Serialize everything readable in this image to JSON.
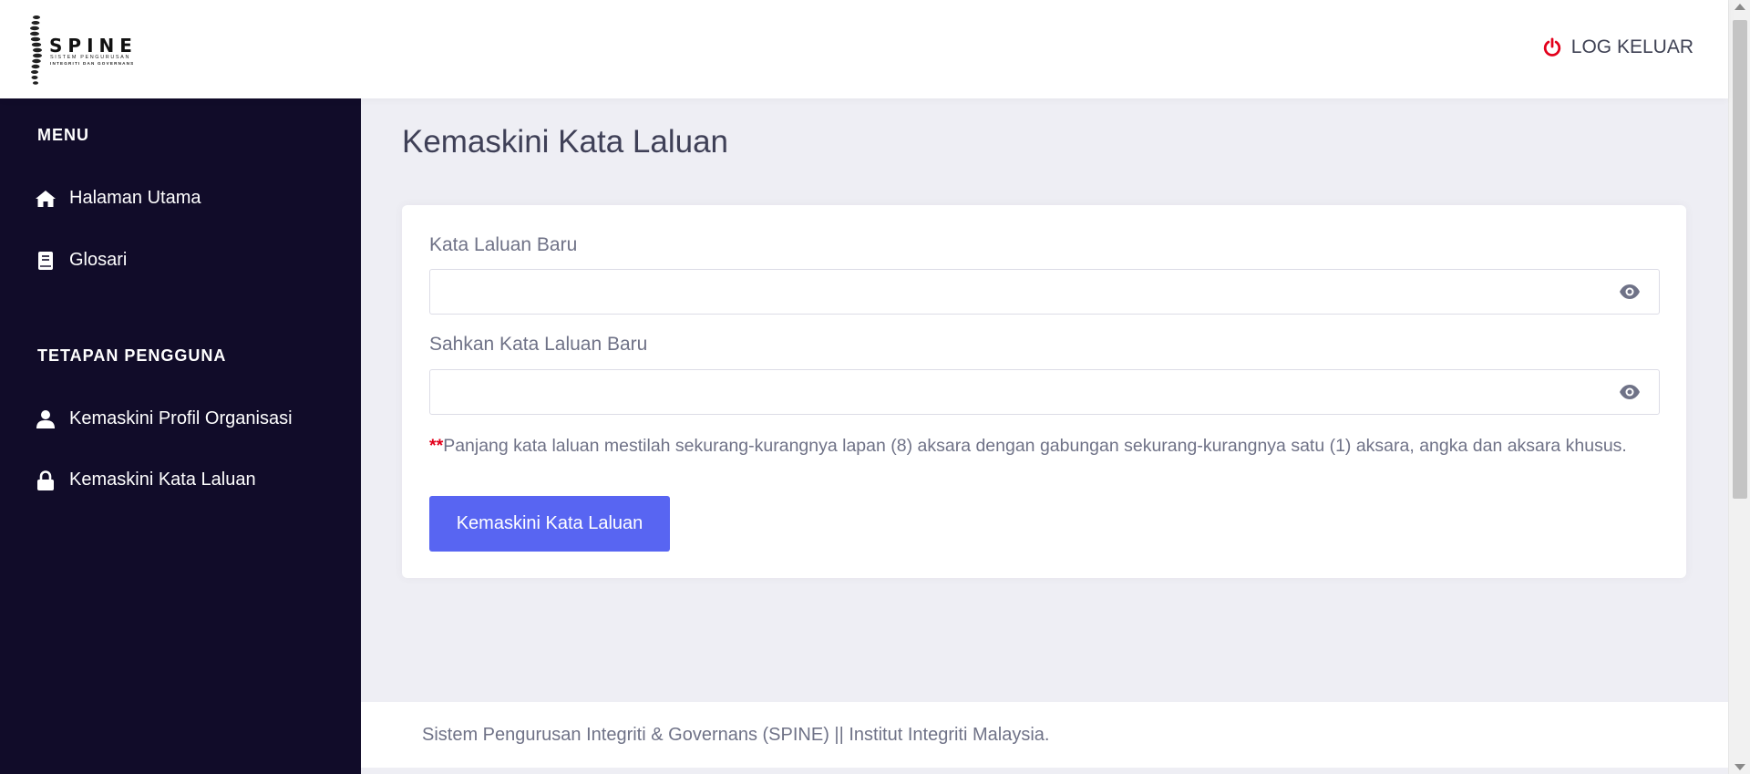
{
  "header": {
    "logo": {
      "name": "SPINE",
      "subtitle_line1": "SISTEM PENGURUSAN",
      "subtitle_line2": "INTEGRITI DAN GOVERNANS"
    },
    "logout_label": "LOG KELUAR",
    "logout_icon": "power-icon",
    "logout_icon_color": "#e3001b"
  },
  "sidebar": {
    "menu_heading": "MENU",
    "menu_items": [
      {
        "label": "Halaman Utama",
        "icon": "home-icon"
      },
      {
        "label": "Glosari",
        "icon": "book-icon"
      }
    ],
    "settings_heading": "TETAPAN PENGGUNA",
    "settings_items": [
      {
        "label": "Kemaskini Profil Organisasi",
        "icon": "user-icon"
      },
      {
        "label": "Kemaskini Kata Laluan",
        "icon": "lock-icon"
      }
    ],
    "background": "#110c29"
  },
  "main": {
    "title": "Kemaskini Kata Laluan",
    "form": {
      "new_password_label": "Kata Laluan Baru",
      "new_password_value": "",
      "confirm_password_label": "Sahkan Kata Laluan Baru",
      "confirm_password_value": "",
      "note_marker": "**",
      "note_text": "Panjang kata laluan mestilah sekurang-kurangnya lapan (8) aksara dengan gabungan sekurang-kurangnya satu (1) aksara, angka dan aksara khusus.",
      "submit_label": "Kemaskini Kata Laluan",
      "accent_color": "#5865f2"
    }
  },
  "footer": {
    "text": "Sistem Pengurusan Integriti & Governans (SPINE) || Institut Integriti Malaysia."
  }
}
